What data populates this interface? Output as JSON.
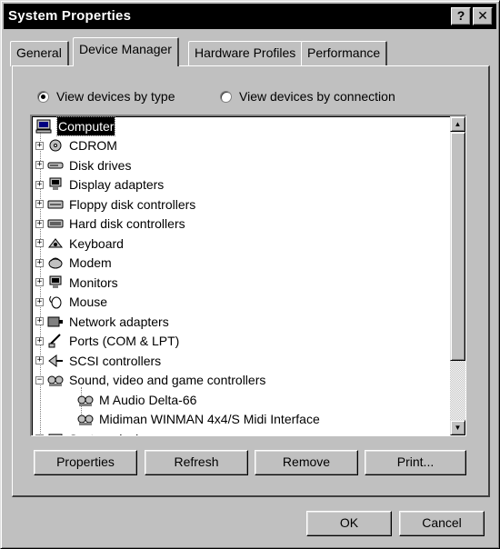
{
  "window": {
    "title": "System Properties",
    "help_label": "?",
    "close_label": "✕"
  },
  "tabs": [
    {
      "label": "General"
    },
    {
      "label": "Device Manager",
      "active": true
    },
    {
      "label": "Hardware Profiles"
    },
    {
      "label": "Performance"
    }
  ],
  "view": {
    "by_type_label": "View devices by type",
    "by_connection_label": "View devices by connection",
    "selected": "by_type"
  },
  "tree": {
    "root": {
      "label": "Computer",
      "icon": "computer-icon",
      "selected": true
    },
    "items": [
      {
        "label": "CDROM",
        "icon": "cdrom-icon",
        "expander": "+"
      },
      {
        "label": "Disk drives",
        "icon": "disk-drive-icon",
        "expander": "+"
      },
      {
        "label": "Display adapters",
        "icon": "display-adapter-icon",
        "expander": "+"
      },
      {
        "label": "Floppy disk controllers",
        "icon": "floppy-controller-icon",
        "expander": "+"
      },
      {
        "label": "Hard disk controllers",
        "icon": "hard-disk-controller-icon",
        "expander": "+"
      },
      {
        "label": "Keyboard",
        "icon": "keyboard-icon",
        "expander": "+"
      },
      {
        "label": "Modem",
        "icon": "modem-icon",
        "expander": "+"
      },
      {
        "label": "Monitors",
        "icon": "monitor-icon",
        "expander": "+"
      },
      {
        "label": "Mouse",
        "icon": "mouse-icon",
        "expander": "+"
      },
      {
        "label": "Network adapters",
        "icon": "network-adapter-icon",
        "expander": "+"
      },
      {
        "label": "Ports (COM & LPT)",
        "icon": "ports-icon",
        "expander": "+"
      },
      {
        "label": "SCSI controllers",
        "icon": "scsi-icon",
        "expander": "+"
      },
      {
        "label": "Sound, video and game controllers",
        "icon": "sound-icon",
        "expander": "−"
      }
    ],
    "children": [
      {
        "label": "M Audio Delta-66",
        "icon": "sound-device-icon"
      },
      {
        "label": "Midiman WINMAN 4x4/S Midi Interface",
        "icon": "sound-device-icon"
      }
    ],
    "partial_item": {
      "label": "System devices",
      "icon": "system-devices-icon",
      "expander": "+"
    }
  },
  "actions": {
    "properties": "Properties",
    "refresh": "Refresh",
    "remove": "Remove",
    "print": "Print..."
  },
  "dialog": {
    "ok": "OK",
    "cancel": "Cancel"
  }
}
